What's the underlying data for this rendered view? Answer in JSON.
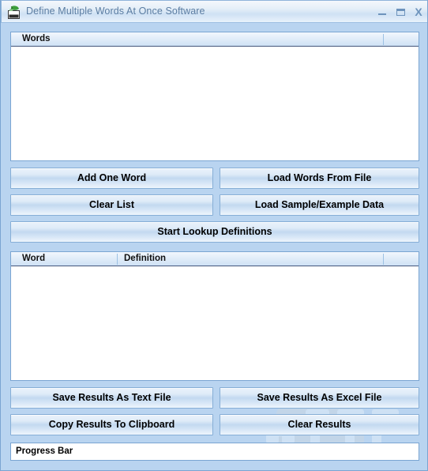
{
  "window": {
    "title": "Define Multiple Words At Once Software",
    "icon": "dictionary-icon",
    "controls": {
      "minimize": "–",
      "maximize": "▭",
      "close": "X"
    },
    "frame_color": "#b9d4f0",
    "border_color": "#7aa5d2"
  },
  "words_list": {
    "columns": [
      "Words"
    ],
    "rows": []
  },
  "action_buttons": {
    "add_one_word": "Add One Word",
    "load_words_from_file": "Load Words From File",
    "clear_list": "Clear List",
    "load_sample_example_data": "Load Sample/Example Data",
    "start_lookup_definitions": "Start Lookup Definitions"
  },
  "results_table": {
    "columns": [
      "Word",
      "Definition"
    ],
    "rows": []
  },
  "result_buttons": {
    "save_results_as_text_file": "Save Results As Text File",
    "save_results_as_excel_file": "Save Results As Excel File",
    "copy_results_to_clipboard": "Copy Results To Clipboard",
    "clear_results": "Clear Results"
  },
  "progress": {
    "label": "Progress Bar",
    "value": 0
  },
  "watermark": {
    "text": "PTF"
  }
}
